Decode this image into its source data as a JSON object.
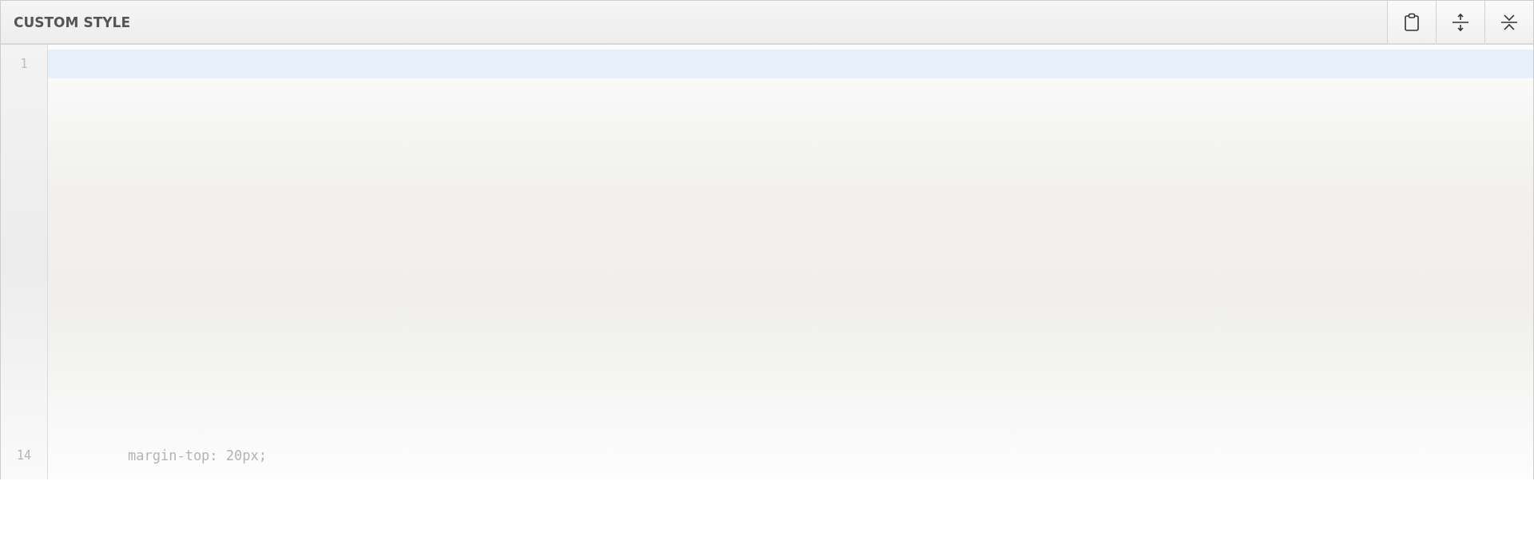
{
  "panel": {
    "title": "CUSTOM STYLE",
    "buttons": [
      {
        "kind": "clipboard"
      },
      {
        "kind": "expand"
      },
      {
        "kind": "collapse"
      }
    ]
  },
  "editor": {
    "lines": [
      {
        "number": "1",
        "current": true
      },
      {
        "number": "14",
        "text": "margin-top: 20px;",
        "current": false
      }
    ]
  }
}
